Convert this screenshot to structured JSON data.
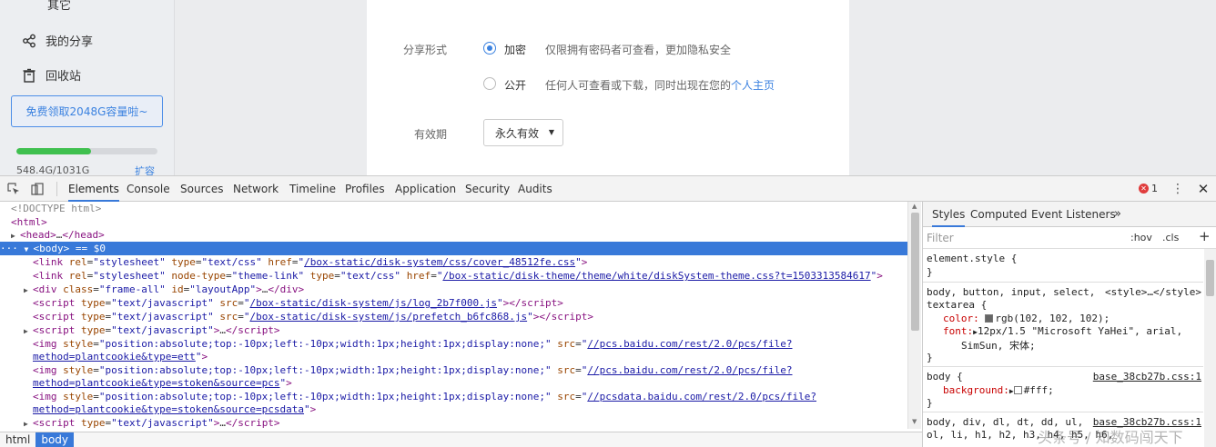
{
  "sidebar": {
    "other_label": "其它",
    "share_label": "我的分享",
    "recycle_label": "回收站",
    "promo_label": "免费领取2048G容量啦~",
    "storage_text": "548.4G/1031G",
    "storage_fraction": 0.53,
    "expand_label": "扩容"
  },
  "modal": {
    "share_form_label": "分享形式",
    "option_private": {
      "label": "加密",
      "desc": "仅限拥有密码者可查看，更加隐私安全",
      "checked": true
    },
    "option_public": {
      "label": "公开",
      "desc": "任何人可查看或下载，同时出现在您的",
      "link": "个人主页",
      "checked": false
    },
    "validity_label": "有效期",
    "validity_value": "永久有效"
  },
  "devtools": {
    "tabs": [
      "Elements",
      "Console",
      "Sources",
      "Network",
      "Timeline",
      "Profiles",
      "Application",
      "Security",
      "Audits"
    ],
    "active_tab": "Elements",
    "error_count": "1",
    "breadcrumb": [
      "html",
      "body"
    ],
    "styles_tabs": [
      "Styles",
      "Computed",
      "Event Listeners"
    ],
    "filter_placeholder": "Filter",
    "hov_label": ":hov",
    "cls_label": ".cls",
    "colors": {
      "accent": "#3879d9",
      "error": "#e03c3c"
    }
  },
  "dom": {
    "l0": "<!DOCTYPE html>",
    "l1": "<html>",
    "l2_open": "<head>",
    "l2_close": "</head>",
    "l3_tag": "<body>",
    "l3_eq": " == $0",
    "link1_href": "/box-static/disk-system/css/cover_48512fe.css",
    "link2_href": "/box-static/disk-theme/theme/white/diskSystem-theme.css?t=1503313584617",
    "div_class": "frame-all",
    "div_id": "layoutApp",
    "script1_src": "/box-static/disk-system/js/log_2b7f000.js",
    "script2_src": "/box-static/disk-system/js/prefetch_b6fc868.js",
    "img_style": "position:absolute;top:-10px;left:-10px;width:1px;height:1px;display:none;",
    "img1_src_a": "//pcs.baidu.com/rest/2.0/pcs/file?",
    "img1_src_b": "method=plantcookie&type=ett",
    "img2_src_a": "//pcs.baidu.com/rest/2.0/pcs/file?",
    "img2_src_b": "method=plantcookie&type=stoken&source=pcs",
    "img3_src_a": "//pcsdata.baidu.com/rest/2.0/pcs/file?",
    "img3_src_b": "method=plantcookie&type=stoken&source=pcsdata"
  },
  "styles": {
    "element_style": "element.style {",
    "close": "}",
    "rule2_selector_a": "body, button, input, select,",
    "rule2_origin": "<style>…</style>",
    "rule2_selector_b": "textarea {",
    "rule2_color_prop": "color:",
    "rule2_color_val": "rgb(102, 102, 102);",
    "rule2_font_prop": "font:",
    "rule2_font_val": "12px/1.5 \"Microsoft YaHei\", arial,",
    "rule2_font_val2": "SimSun, 宋体;",
    "rule3_selector": "body {",
    "rule3_source": "base_38cb27b.css:1",
    "rule3_prop": "background:",
    "rule3_val": "#fff;",
    "rule4_selector_a": "body, div, dl, dt, dd, ul,",
    "rule4_source": "base_38cb27b.css:1",
    "rule4_selector_b": "ol, li, h1, h2, h3, h4, h5, h6,"
  },
  "watermark": "头条号 / 知数码闯天下"
}
